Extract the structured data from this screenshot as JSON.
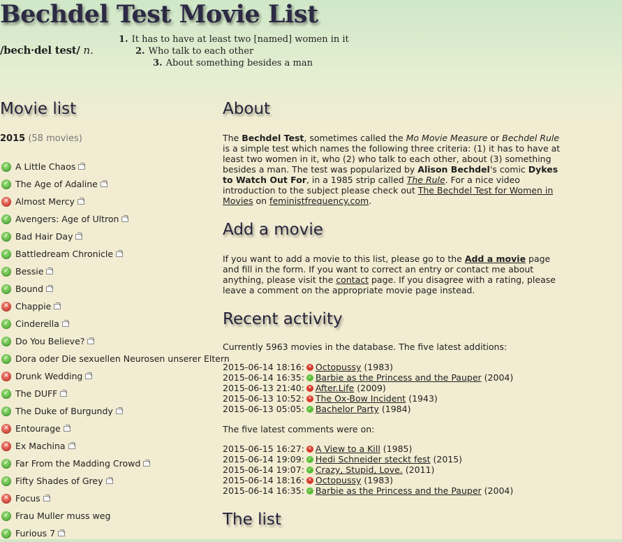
{
  "header": {
    "title": "Bechdel Test Movie List",
    "pron_word": "/bech·del test/",
    "pron_pos": "n.",
    "criteria": [
      {
        "num": "1.",
        "text": "It has to have at least two [named] women in it"
      },
      {
        "num": "2.",
        "text": "Who talk to each other"
      },
      {
        "num": "3.",
        "text": "About something besides a man"
      }
    ]
  },
  "movie_list": {
    "heading": "Movie list",
    "year": "2015",
    "count": "(58 movies)",
    "movies": [
      {
        "title": "A Little Chaos",
        "status": "pass",
        "ext": true
      },
      {
        "title": "The Age of Adaline",
        "status": "pass",
        "ext": true
      },
      {
        "title": "Almost Mercy",
        "status": "fail",
        "ext": true
      },
      {
        "title": "Avengers: Age of Ultron",
        "status": "pass",
        "ext": true
      },
      {
        "title": "Bad Hair Day",
        "status": "pass",
        "ext": true
      },
      {
        "title": "Battledream Chronicle",
        "status": "pass",
        "ext": true
      },
      {
        "title": "Bessie",
        "status": "pass",
        "ext": true
      },
      {
        "title": "Bound",
        "status": "pass",
        "ext": true
      },
      {
        "title": "Chappie",
        "status": "fail",
        "ext": true
      },
      {
        "title": "Cinderella",
        "status": "pass",
        "ext": true
      },
      {
        "title": "Do You Believe?",
        "status": "pass",
        "ext": true
      },
      {
        "title": "Dora oder Die sexuellen Neurosen unserer Eltern",
        "status": "pass",
        "ext": false
      },
      {
        "title": "Drunk Wedding",
        "status": "fail",
        "ext": true
      },
      {
        "title": "The DUFF",
        "status": "pass",
        "ext": true
      },
      {
        "title": "The Duke of Burgundy",
        "status": "pass",
        "ext": true
      },
      {
        "title": "Entourage",
        "status": "fail",
        "ext": true
      },
      {
        "title": "Ex Machina",
        "status": "fail",
        "ext": true
      },
      {
        "title": "Far From the Madding Crowd",
        "status": "pass",
        "ext": true
      },
      {
        "title": "Fifty Shades of Grey",
        "status": "pass",
        "ext": true
      },
      {
        "title": "Focus",
        "status": "fail",
        "ext": true
      },
      {
        "title": "Frau Muller muss weg",
        "status": "pass",
        "ext": false
      },
      {
        "title": "Furious 7",
        "status": "pass",
        "ext": true
      }
    ]
  },
  "about": {
    "heading": "About",
    "t1": "The ",
    "b1": "Bechdel Test",
    "t2": ", sometimes called the ",
    "i1": "Mo Movie Measure",
    "t3": " or ",
    "i2": "Bechdel Rule",
    "t4": " is a simple test which names the following three criteria: (1) it has to have at least two women in it, who (2) who talk to each other, about (3) something besides a man. The test was popularized by ",
    "b2": "Alison Bechdel",
    "t5": "'s comic ",
    "b3": "Dykes to Watch Out For",
    "t6": ", in a 1985 strip called ",
    "link1": "The Rule",
    "t7": ". For a nice video introduction to the subject please check out ",
    "link2": "The Bechdel Test for Women in Movies",
    "t8": " on ",
    "link3": "feministfrequency.com",
    "t9": "."
  },
  "add_movie": {
    "heading": "Add a movie",
    "t1": "If you want to add a movie to this list, please go to the ",
    "link1": "Add a movie",
    "t2": " page and fill in the form. If you want to correct an entry or contact me about anything, please visit the ",
    "link2": "contact",
    "t3": " page. If you disagree with a rating, please leave a comment on the appropriate movie page instead."
  },
  "recent": {
    "heading": "Recent activity",
    "summary": "Currently 5963 movies in the database. The five latest additions:",
    "additions": [
      {
        "time": "2015-06-14 18:16:",
        "status": "fail",
        "title": "Octopussy",
        "year": "(1983)"
      },
      {
        "time": "2015-06-14 16:35:",
        "status": "pass",
        "title": "Barbie as the Princess and the Pauper",
        "year": "(2004)"
      },
      {
        "time": "2015-06-13 21:40:",
        "status": "fail",
        "title": "After.Life",
        "year": "(2009)"
      },
      {
        "time": "2015-06-13 10:52:",
        "status": "fail",
        "title": "The Ox-Bow Incident",
        "year": "(1943)"
      },
      {
        "time": "2015-06-13 05:05:",
        "status": "pass",
        "title": "Bachelor Party",
        "year": "(1984)"
      }
    ],
    "comments_intro": "The five latest comments were on:",
    "comments": [
      {
        "time": "2015-06-15 16:27:",
        "status": "fail",
        "title": "A View to a Kill",
        "year": "(1985)"
      },
      {
        "time": "2015-06-14 19:09:",
        "status": "pass",
        "title": "Hedi Schneider steckt fest",
        "year": "(2015)"
      },
      {
        "time": "2015-06-14 19:07:",
        "status": "pass",
        "title": "Crazy, Stupid, Love.",
        "year": "(2011)"
      },
      {
        "time": "2015-06-14 18:16:",
        "status": "fail",
        "title": "Octopussy",
        "year": "(1983)"
      },
      {
        "time": "2015-06-14 16:35:",
        "status": "pass",
        "title": "Barbie as the Princess and the Pauper",
        "year": "(2004)"
      }
    ]
  },
  "the_list": {
    "heading": "The list"
  }
}
